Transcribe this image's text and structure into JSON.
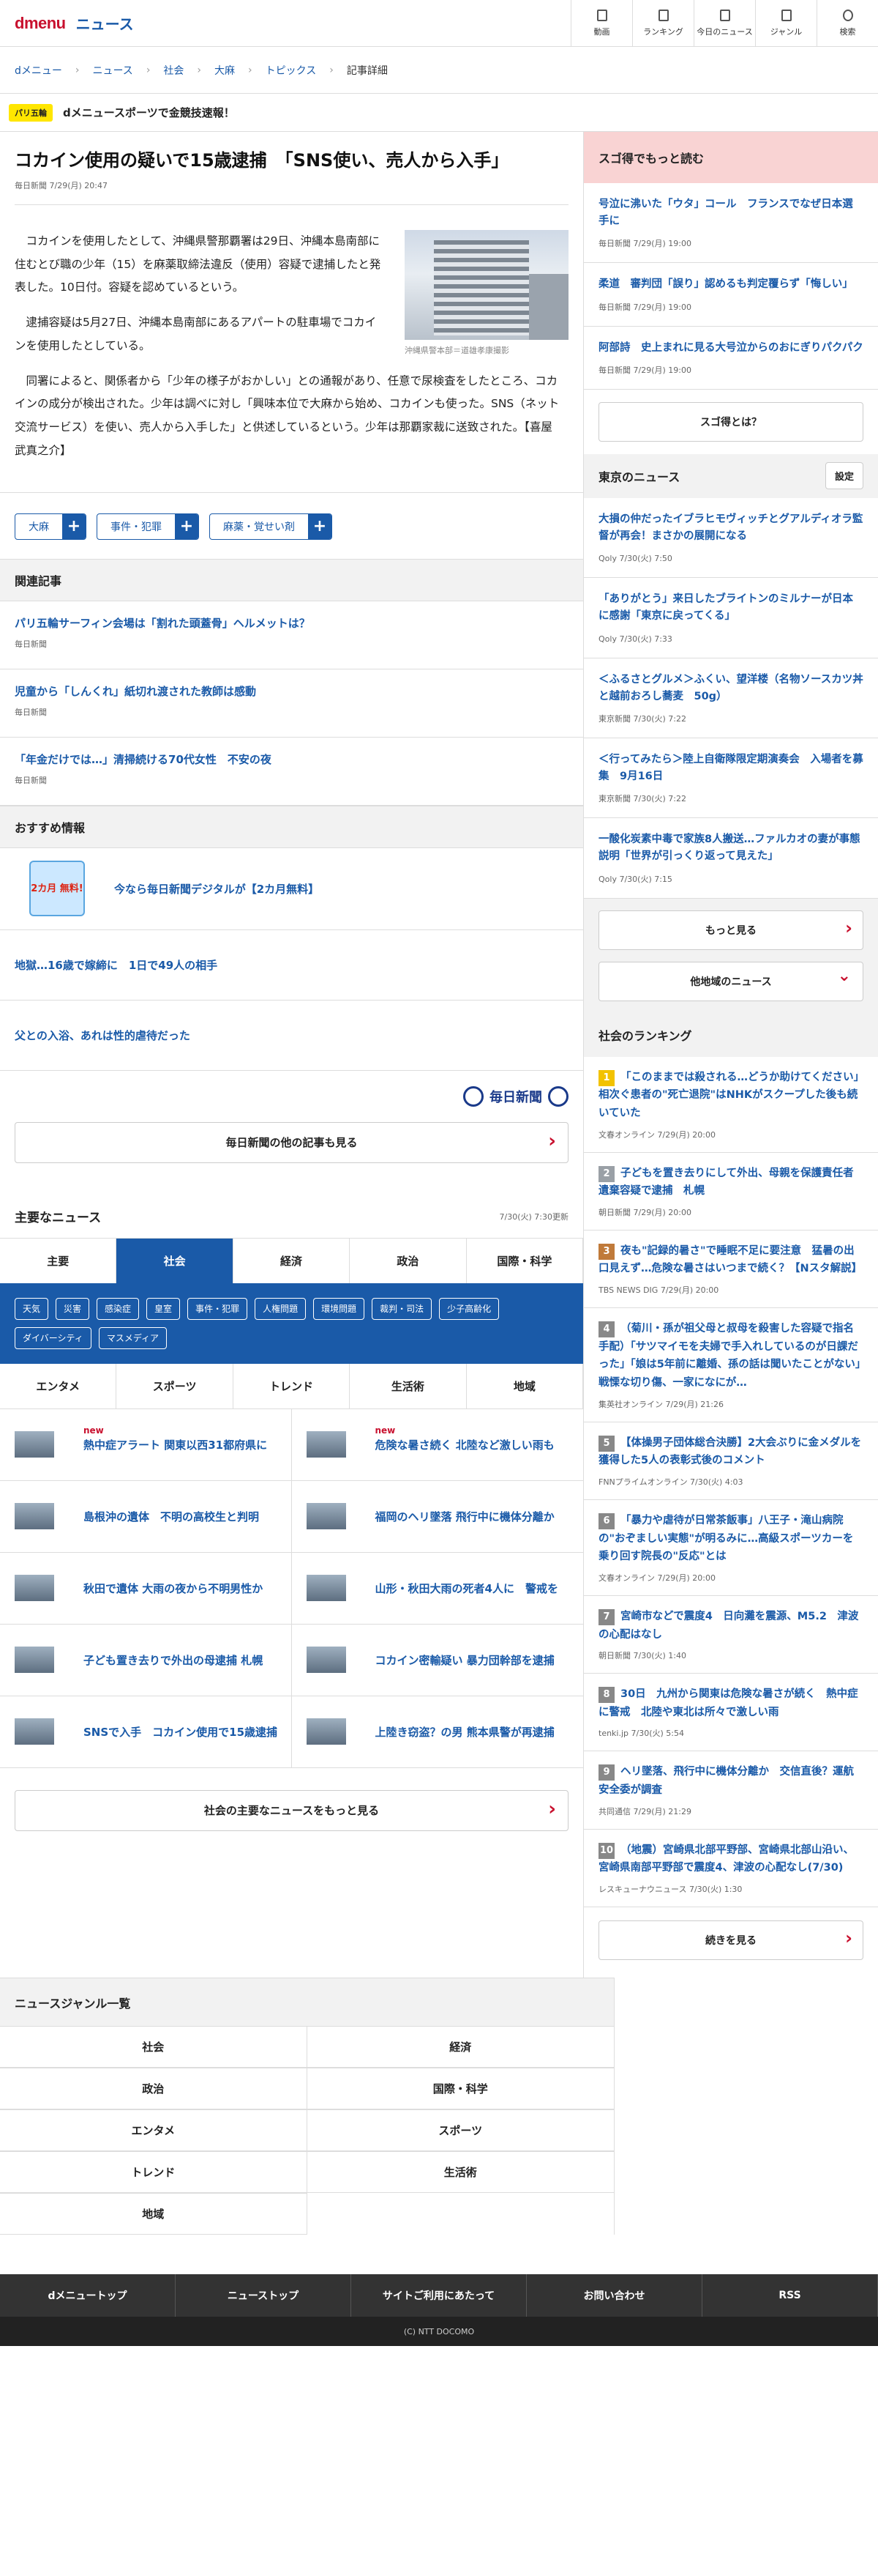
{
  "header": {
    "logo": "dmenu",
    "section": "ニュース",
    "nav": [
      "動画",
      "ランキング",
      "今日のニュース",
      "ジャンル",
      "検索"
    ]
  },
  "breadcrumb": [
    "dメニュー",
    "ニュース",
    "社会",
    "大麻",
    "トピックス",
    "記事詳細"
  ],
  "flash": {
    "tag": "パリ五輪",
    "text": "dメニュースポーツで金競技速報！"
  },
  "article": {
    "title": "コカイン使用の疑いで15歳逮捕　「SNS使い、売人から入手」",
    "source": "毎日新聞 7/29(月) 20:47",
    "paragraphs": [
      "コカインを使用したとして、沖縄県警那覇署は29日、沖縄本島南部に住むとび職の少年（15）を麻薬取締法違反（使用）容疑で逮捕したと発表した。10日付。容疑を認めているという。",
      "逮捕容疑は5月27日、沖縄本島南部にあるアパートの駐車場でコカインを使用したとしている。",
      "同署によると、関係者から「少年の様子がおかしい」との通報があり、任意で尿検査をしたところ、コカインの成分が検出された。少年は調べに対し「興味本位で大麻から始め、コカインも使った。SNS（ネット交流サービス）を使い、売人から入手した」と供述しているという。少年は那覇家裁に送致された。【喜屋武真之介】"
    ],
    "photo_caption": "沖縄県警本部＝道雄孝康撮影",
    "tags": [
      "大麻",
      "事件・犯罪",
      "麻薬・覚せい剤"
    ]
  },
  "related": {
    "heading": "関連記事",
    "items": [
      {
        "title": "パリ五輪サーフィン会場は「割れた頭蓋骨」ヘルメットは？",
        "source": "毎日新聞"
      },
      {
        "title": "児童から「しんくれ」紙切れ渡された教師は感動",
        "source": "毎日新聞"
      },
      {
        "title": "「年金だけでは…」清掃続ける70代女性　不安の夜",
        "source": "毎日新聞"
      }
    ]
  },
  "recommend": {
    "heading": "おすすめ情報",
    "banner": "2カ月 無料!",
    "items": [
      "今なら毎日新聞デジタルが【2カ月無料】",
      "地獄…16歳で嫁締に　1日で49人の相手",
      "父との入浴、あれは性的虐待だった"
    ],
    "logo": "毎日新聞",
    "more": "毎日新聞の他の記事も見る"
  },
  "main_news": {
    "heading": "主要なニュース",
    "updated": "7/30(火) 7:30更新",
    "tabs": [
      "主要",
      "社会",
      "経済",
      "政治",
      "国際・科学"
    ],
    "subtags": [
      "天気",
      "災害",
      "感染症",
      "皇室",
      "事件・犯罪",
      "人権問題",
      "環境問題",
      "裁判・司法",
      "少子高齢化",
      "ダイバーシティ",
      "マスメディア"
    ],
    "tabs2": [
      "エンタメ",
      "スポーツ",
      "トレンド",
      "生活術",
      "地域"
    ],
    "items": [
      {
        "title": "熱中症アラート 関東以西31都府県に",
        "new": "new"
      },
      {
        "title": "危険な暑さ続く 北陸など激しい雨も",
        "new": "new"
      },
      {
        "title": "島根沖の遺体　不明の高校生と判明",
        "new": ""
      },
      {
        "title": "福岡のヘリ墜落 飛行中に機体分離か",
        "new": ""
      },
      {
        "title": "秋田で遺体 大雨の夜から不明男性か",
        "new": ""
      },
      {
        "title": "山形・秋田大雨の死者4人に　警戒を",
        "new": ""
      },
      {
        "title": "子ども置き去りで外出の母逮捕 札幌",
        "new": ""
      },
      {
        "title": "コカイン密輸疑い 暴力団幹部を逮捕",
        "new": ""
      },
      {
        "title": "SNSで入手　コカイン使用で15歳逮捕",
        "new": ""
      },
      {
        "title": "上陸き窃盗？の男 熊本県警が再逮捕",
        "new": ""
      }
    ],
    "more": "社会の主要なニュースをもっと見る"
  },
  "sidebar": {
    "heading": "スゴ得でもっと読む",
    "items": [
      {
        "title": "号泣に沸いた「ウタ」コール　フランスでなぜ日本選手に",
        "source": "毎日新聞 7/29(月) 19:00"
      },
      {
        "title": "柔道　審判団「誤り」認めるも判定覆らず「悔しい」",
        "source": "毎日新聞 7/29(月) 19:00"
      },
      {
        "title": "阿部詩　史上まれに見る大号泣からのおにぎりパクパク",
        "source": "毎日新聞 7/29(月) 19:00"
      }
    ],
    "about": "スゴ得とは？",
    "local": {
      "heading": "東京のニュース",
      "setting": "設定",
      "items": [
        {
          "title": "大損の仲だったイブラヒモヴィッチとグアルディオラ監督が再会！まさかの展開になる",
          "source": "Qoly 7/30(火) 7:50"
        },
        {
          "title": "「ありがとう」来日したブライトンのミルナーが日本に感謝「東京に戻ってくる」",
          "source": "Qoly 7/30(火) 7:33"
        },
        {
          "title": "＜ふるさとグルメ＞ふくい、望洋楼（名物ソースカツ丼と越前おろし蕎麦　50g）",
          "source": "東京新聞 7/30(火) 7:22"
        },
        {
          "title": "＜行ってみたら＞陸上自衛隊限定期演奏会　入場者を募集　9月16日",
          "source": "東京新聞 7/30(火) 7:22"
        },
        {
          "title": "一酸化炭素中毒で家族8人搬送…ファルカオの妻が事態説明「世界が引っくり返って見えた」",
          "source": "Qoly 7/30(火) 7:15"
        }
      ],
      "more": "もっと見る",
      "other": "他地域のニュース"
    },
    "ranking": {
      "heading": "社会のランキング",
      "items": [
        {
          "rank": "1",
          "color": "#f2c200",
          "title": "「このままでは殺される…どうか助けてください」相次ぐ患者の\"死亡退院\"はNHKがスクープした後も続いていた",
          "source": "文春オンライン 7/29(月) 20:00"
        },
        {
          "rank": "2",
          "color": "#9aa0a6",
          "title": "子どもを置き去りにして外出、母親を保護責任者遺棄容疑で逮捕　札幌",
          "source": "朝日新聞 7/29(月) 20:00"
        },
        {
          "rank": "3",
          "color": "#c07a3a",
          "title": "夜も\"記録的暑さ\"で睡眠不足に要注意　猛暑の出口見えず…危険な暑さはいつまで続く？【Nスタ解説】",
          "source": "TBS NEWS DIG 7/29(月) 20:00"
        },
        {
          "rank": "4",
          "color": "#888",
          "title": "（菊川・孫が祖父母と叔母を殺害した容疑で指名手配）「サツマイモを夫婦で手入れしているのが日課だった」「娘は5年前に離婚、孫の話は聞いたことがない」戦慄な切り傷、一家になにが…",
          "source": "集英社オンライン 7/29(月) 21:26"
        },
        {
          "rank": "5",
          "color": "#888",
          "title": "【体操男子団体総合決勝】2大会ぶりに金メダルを獲得した5人の表彰式後のコメント",
          "source": "FNNプライムオンライン 7/30(火) 4:03"
        },
        {
          "rank": "6",
          "color": "#888",
          "title": "「暴力や虐待が日常茶飯事」八王子・滝山病院の\"おぞましい実態\"が明るみに…高級スポーツカーを乗り回す院長の\"反応\"とは",
          "source": "文春オンライン 7/29(月) 20:00"
        },
        {
          "rank": "7",
          "color": "#888",
          "title": "宮崎市などで震度4　日向灘を震源、M5.2　津波の心配はなし",
          "source": "朝日新聞 7/30(火) 1:40"
        },
        {
          "rank": "8",
          "color": "#888",
          "title": "30日　九州から関東は危険な暑さが続く　熱中症に警戒　北陸や東北は所々で激しい雨",
          "source": "tenki.jp 7/30(火) 5:54"
        },
        {
          "rank": "9",
          "color": "#888",
          "title": "ヘリ墜落、飛行中に機体分離か　交信直後？運航安全委が調査",
          "source": "共同通信 7/29(月) 21:29"
        },
        {
          "rank": "10",
          "color": "#888",
          "title": "（地震）宮崎県北部平野部、宮崎県北部山沿い、宮崎県南部平野部で震度4、津波の心配なし(7/30)",
          "source": "レスキューナウニュース 7/30(火) 1:30"
        }
      ],
      "more": "続きを見る"
    }
  },
  "genres": {
    "heading": "ニュースジャンル一覧",
    "items": [
      "社会",
      "経済",
      "政治",
      "国際・科学",
      "エンタメ",
      "スポーツ",
      "トレンド",
      "生活術",
      "地域"
    ]
  },
  "footer": {
    "links": [
      "dメニュートップ",
      "ニューストップ",
      "サイトご利用にあたって",
      "お問い合わせ",
      "RSS"
    ],
    "copyright": "(C) NTT DOCOMO"
  }
}
